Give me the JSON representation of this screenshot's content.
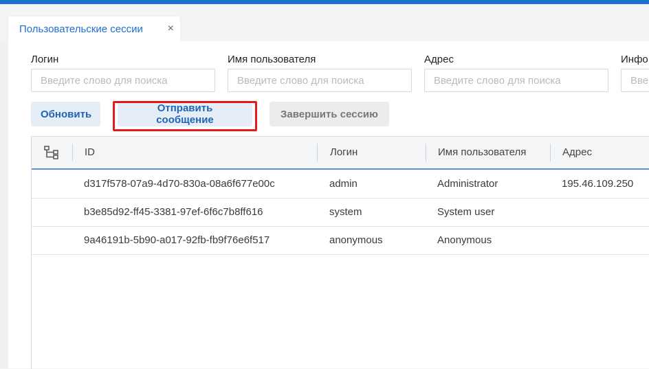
{
  "colors": {
    "accent": "#1f6fd1",
    "highlight": "#e3191c"
  },
  "tab": {
    "label": "Пользовательские сессии",
    "close": "×"
  },
  "filters": [
    {
      "label": "Логин",
      "placeholder": "Введите слово для поиска",
      "value": ""
    },
    {
      "label": "Имя пользователя",
      "placeholder": "Введите слово для поиска",
      "value": ""
    },
    {
      "label": "Адрес",
      "placeholder": "Введите слово для поиска",
      "value": ""
    },
    {
      "label": "Инфо",
      "placeholder": "Вве",
      "value": ""
    }
  ],
  "toolbar": {
    "refresh_label": "Обновить",
    "send_message_label": "Отправить сообщение",
    "end_session_label": "Завершить сессию"
  },
  "grid": {
    "tree_icon": "tree-structure-icon",
    "columns": [
      "ID",
      "Логин",
      "Имя пользователя",
      "Адрес"
    ],
    "rows": [
      {
        "id": "d317f578-07a9-4d70-830a-08a6f677e00c",
        "login": "admin",
        "username": "Administrator",
        "address": "195.46.109.250"
      },
      {
        "id": "b3e85d92-ff45-3381-97ef-6f6c7b8ff616",
        "login": "system",
        "username": "System user",
        "address": ""
      },
      {
        "id": "9a46191b-5b90-a017-92fb-fb9f76e6f517",
        "login": "anonymous",
        "username": "Anonymous",
        "address": ""
      }
    ]
  }
}
